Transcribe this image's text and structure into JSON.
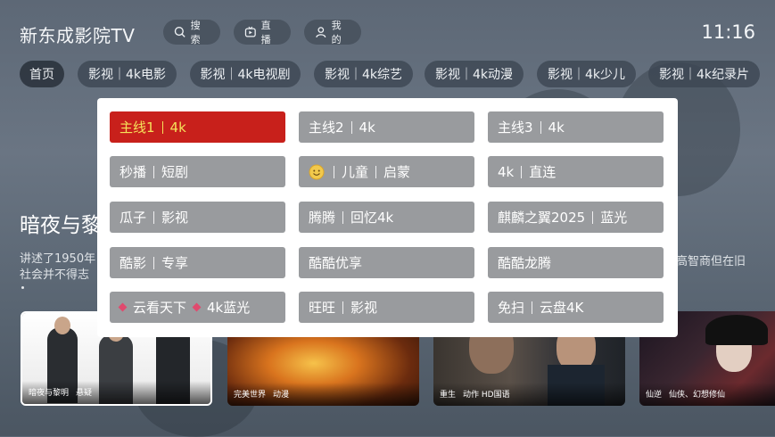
{
  "header": {
    "app_title": "新东成影院TV",
    "buttons": [
      {
        "label": "搜索",
        "icon": "search-icon"
      },
      {
        "label": "直播",
        "icon": "live-tv-icon"
      },
      {
        "label": "我的",
        "icon": "user-icon"
      }
    ],
    "time": "11:16"
  },
  "tabs": [
    {
      "label": "首页",
      "active": true
    },
    {
      "label": "影视｜4k电影"
    },
    {
      "label": "影视｜4k电视剧"
    },
    {
      "label": "影视｜4k综艺"
    },
    {
      "label": "影视｜4k动漫"
    },
    {
      "label": "影视｜4k少儿"
    },
    {
      "label": "影视｜4k纪录片"
    }
  ],
  "hero": {
    "title": "暗夜与黎",
    "desc_left_line1": "讲述了1950年",
    "desc_left_line2": "社会并不得志",
    "desc_right": "高智商但在旧"
  },
  "source_popup": {
    "options": [
      [
        {
          "a": "主线1",
          "b": "4k",
          "selected": true
        },
        {
          "a": "主线2",
          "b": "4k"
        },
        {
          "a": "主线3",
          "b": "4k"
        }
      ],
      [
        {
          "a": "秒播",
          "b": "短剧"
        },
        {
          "a": "儿童",
          "b": "启蒙",
          "icon": "smiley-face-icon"
        },
        {
          "a": "4k",
          "b": "直连"
        }
      ],
      [
        {
          "a": "瓜子",
          "b": "影视"
        },
        {
          "a": "腾腾",
          "b": "回忆4k"
        },
        {
          "a": "麒麟之翼2025",
          "b": "蓝光"
        }
      ],
      [
        {
          "a": "酷影",
          "b": "专享"
        },
        {
          "a": "酷酷优享"
        },
        {
          "a": "酷酷龙腾"
        }
      ],
      [
        {
          "a": "云看天下",
          "b": "4k蓝光",
          "diamond": true
        },
        {
          "a": "旺旺",
          "b": "影视"
        },
        {
          "a": "免扫",
          "b": "云盘4K"
        }
      ]
    ]
  },
  "cards": [
    {
      "title": "暗夜与黎明",
      "tag": "悬疑",
      "focused": true
    },
    {
      "title": "完美世界",
      "tag": "动漫"
    },
    {
      "title": "重生",
      "tag": "动作 HD国语"
    },
    {
      "title": "仙逆",
      "tag": "仙侠、幻想修仙"
    }
  ],
  "colors": {
    "selected_bg": "#c8201b",
    "selected_text": "#f5e15a",
    "option_bg": "#999b9e"
  }
}
